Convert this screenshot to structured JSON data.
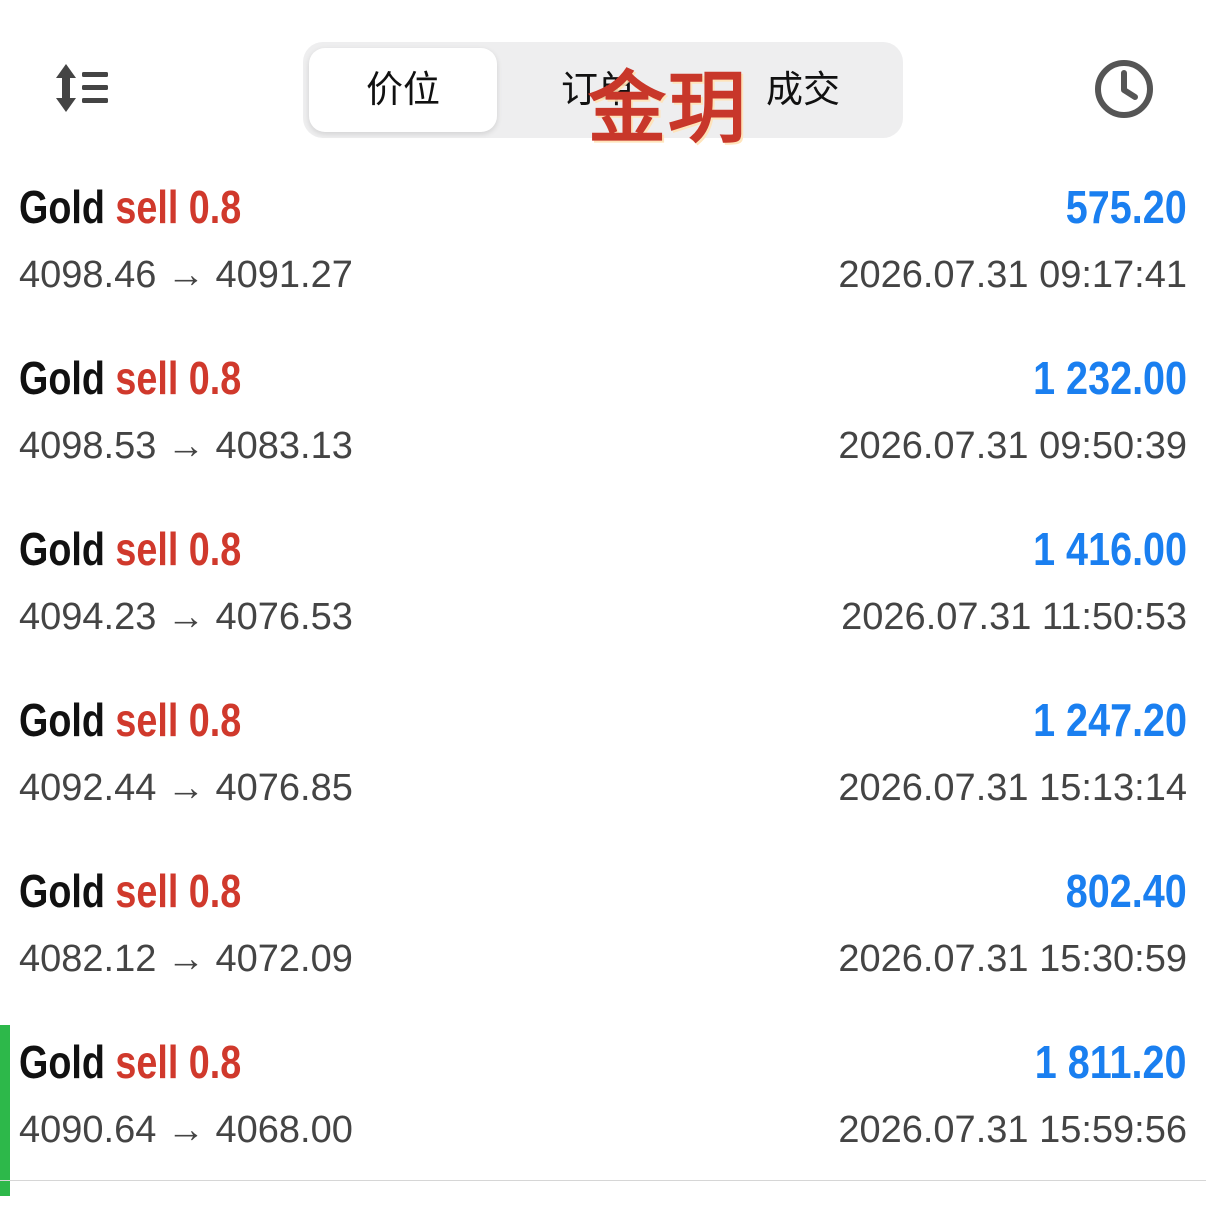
{
  "header": {
    "tabs": [
      {
        "label": "价位",
        "active": true
      },
      {
        "label": "订单",
        "active": false
      },
      {
        "label": "成交",
        "active": false
      }
    ],
    "sort_icon": "sort-icon",
    "history_icon": "clock-icon",
    "watermark": "金玥"
  },
  "colors": {
    "sell": "#d0392c",
    "profit": "#1a7ff0",
    "indicator": "#2db84a"
  },
  "trades": [
    {
      "symbol": "Gold",
      "side": "sell",
      "lots": "0.8",
      "profit": "575.20",
      "prices": "4098.46 → 4091.27",
      "time": "2026.07.31 09:17:41"
    },
    {
      "symbol": "Gold",
      "side": "sell",
      "lots": "0.8",
      "profit": "1 232.00",
      "prices": "4098.53 → 4083.13",
      "time": "2026.07.31 09:50:39"
    },
    {
      "symbol": "Gold",
      "side": "sell",
      "lots": "0.8",
      "profit": "1 416.00",
      "prices": "4094.23 → 4076.53",
      "time": "2026.07.31 11:50:53"
    },
    {
      "symbol": "Gold",
      "side": "sell",
      "lots": "0.8",
      "profit": "1 247.20",
      "prices": "4092.44 → 4076.85",
      "time": "2026.07.31 15:13:14"
    },
    {
      "symbol": "Gold",
      "side": "sell",
      "lots": "0.8",
      "profit": "802.40",
      "prices": "4082.12 → 4072.09",
      "time": "2026.07.31 15:30:59"
    },
    {
      "symbol": "Gold",
      "side": "sell",
      "lots": "0.8",
      "profit": "1 811.20",
      "prices": "4090.64 → 4068.00",
      "time": "2026.07.31 15:59:56",
      "selected": true
    }
  ]
}
